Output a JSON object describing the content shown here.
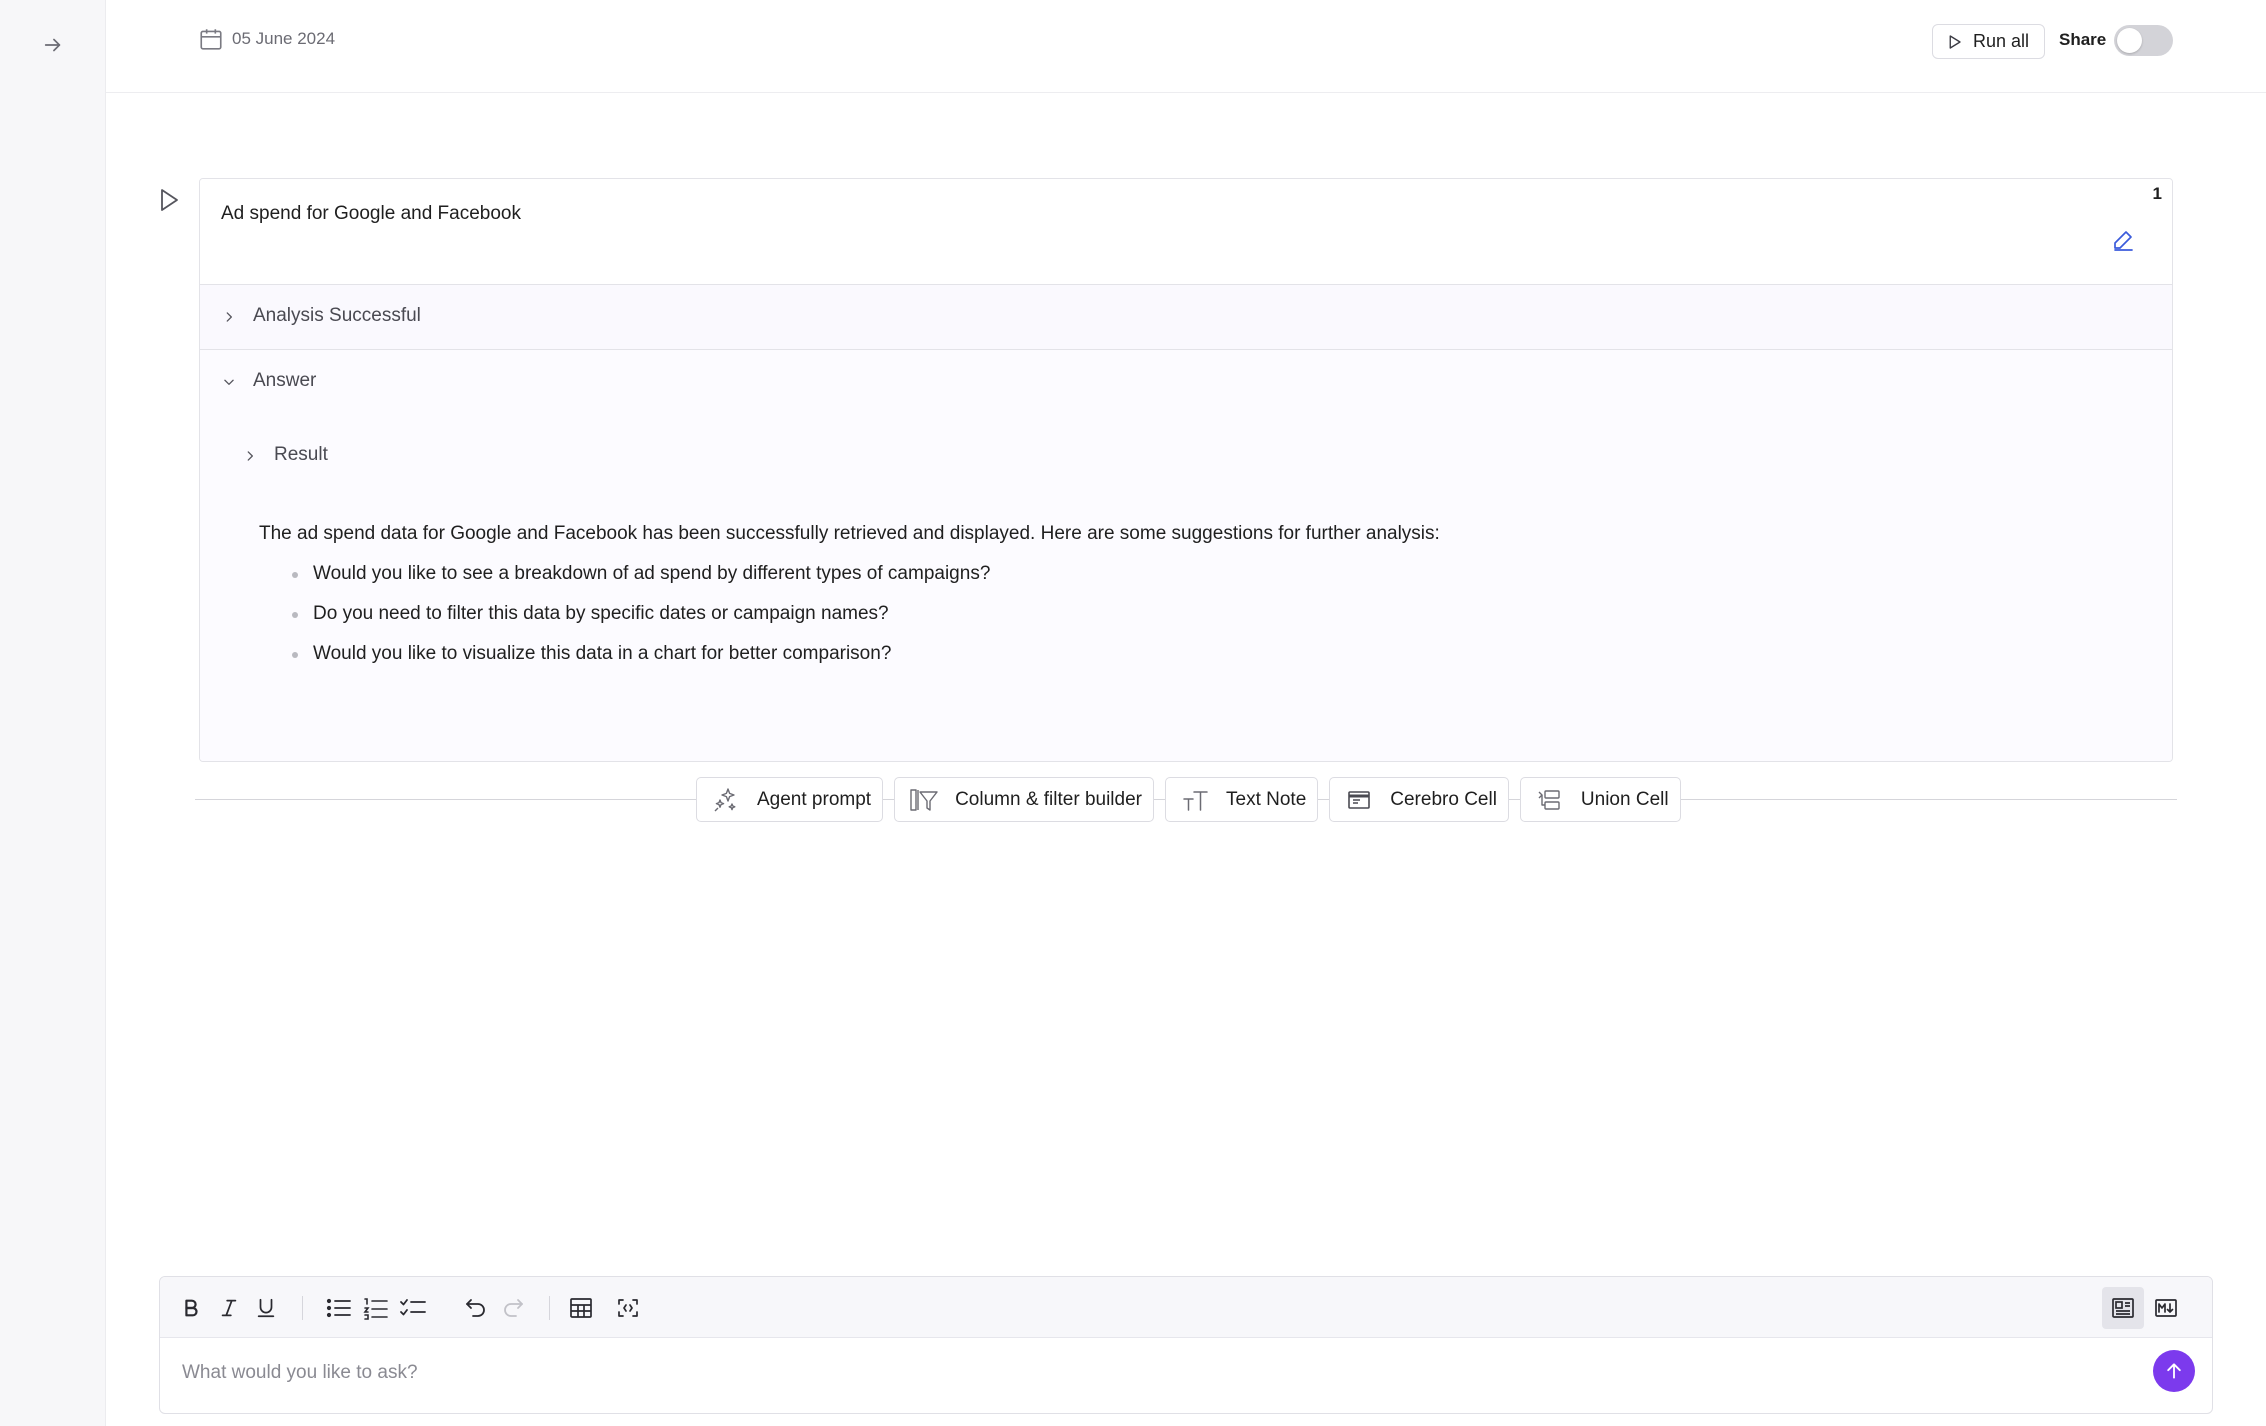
{
  "topbar": {
    "date": "05 June 2024",
    "run_all_label": "Run all",
    "share_label": "Share",
    "share_enabled": false
  },
  "cell": {
    "index": "1",
    "prompt": "Ad spend for Google and Facebook",
    "analysis_label": "Analysis Successful",
    "answer_label": "Answer",
    "result_label": "Result",
    "answer_text": "The ad spend data for Google and Facebook has been successfully retrieved and displayed. Here are some suggestions for further analysis:",
    "suggestions": [
      "Would you like to see a breakdown of ad spend by different types of campaigns?",
      "Do you need to filter this data by specific dates or campaign names?",
      "Would you like to visualize this data in a chart for better comparison?"
    ]
  },
  "add_cell": {
    "buttons": [
      {
        "label": "Agent prompt",
        "icon": "sparkles-icon"
      },
      {
        "label": "Column & filter builder",
        "icon": "column-filter-icon"
      },
      {
        "label": "Text Note",
        "icon": "text-size-icon"
      },
      {
        "label": "Cerebro Cell",
        "icon": "cerebro-icon"
      },
      {
        "label": "Union Cell",
        "icon": "union-icon"
      }
    ]
  },
  "composer": {
    "placeholder": "What would you like to ask?",
    "accent_color": "#7c3aed"
  }
}
